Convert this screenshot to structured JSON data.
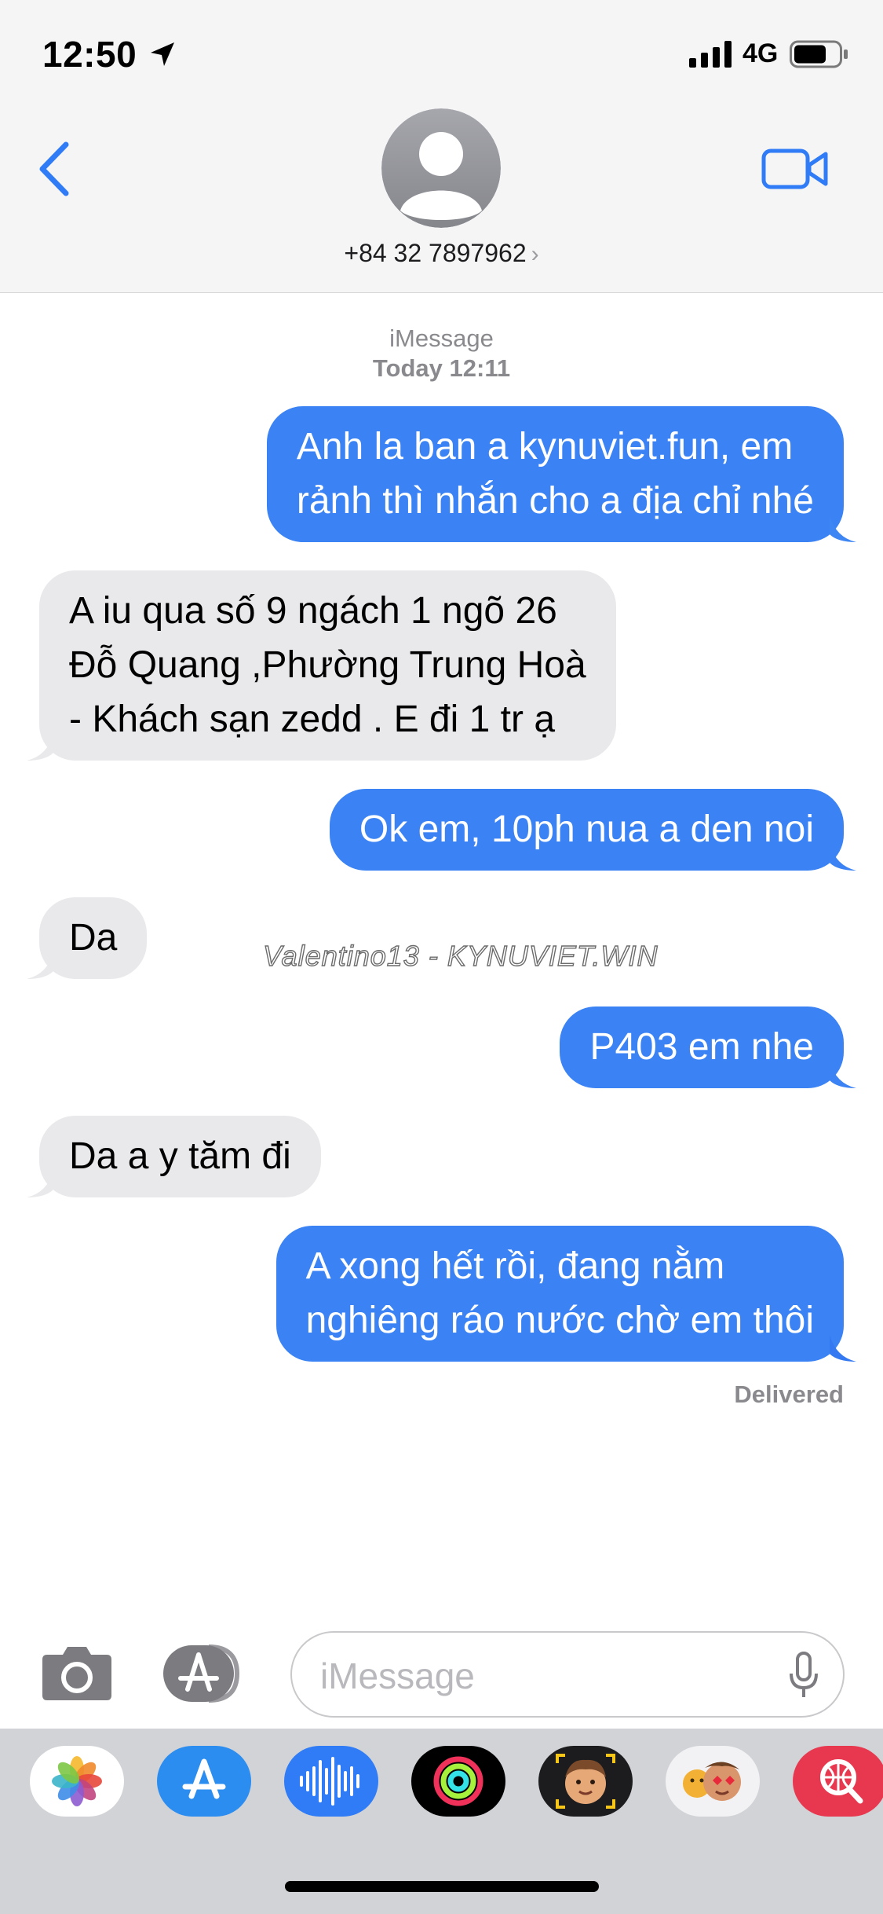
{
  "status_bar": {
    "time": "12:50",
    "network": "4G"
  },
  "header": {
    "contact": "+84 32 7897962",
    "chevron": "›"
  },
  "conversation": {
    "service": "iMessage",
    "timestamp": "Today 12:11",
    "messages": [
      {
        "direction": "out",
        "text": "Anh la ban a kynuviet.fun, em\nrảnh thì nhắn cho a địa chỉ nhé"
      },
      {
        "direction": "in",
        "text": "A iu qua số 9 ngách 1 ngõ 26\nĐỗ Quang ,Phường Trung Hoà\n- Khách sạn zedd . E đi 1 tr ạ"
      },
      {
        "direction": "out",
        "text": "Ok em, 10ph nua a den noi"
      },
      {
        "direction": "in",
        "text": "Da"
      },
      {
        "direction": "out",
        "text": "P403 em nhe"
      },
      {
        "direction": "in",
        "text": "Da a y tăm đi"
      },
      {
        "direction": "out",
        "text": "A xong hết rồi, đang nằm\nnghiêng ráo nước chờ em thôi"
      }
    ],
    "delivered": "Delivered",
    "watermark": "Valentino13 - KYNUVIET.WIN"
  },
  "input": {
    "placeholder": "iMessage"
  },
  "app_drawer": [
    "photos-icon",
    "app-store-icon",
    "audio-message-icon",
    "fitness-icon",
    "memoji-icon",
    "animoji-stickers-icon",
    "web-search-icon"
  ],
  "colors": {
    "bubble_out": "#3b83f4",
    "bubble_in": "#e9e9eb",
    "accent": "#2f7cf6"
  }
}
